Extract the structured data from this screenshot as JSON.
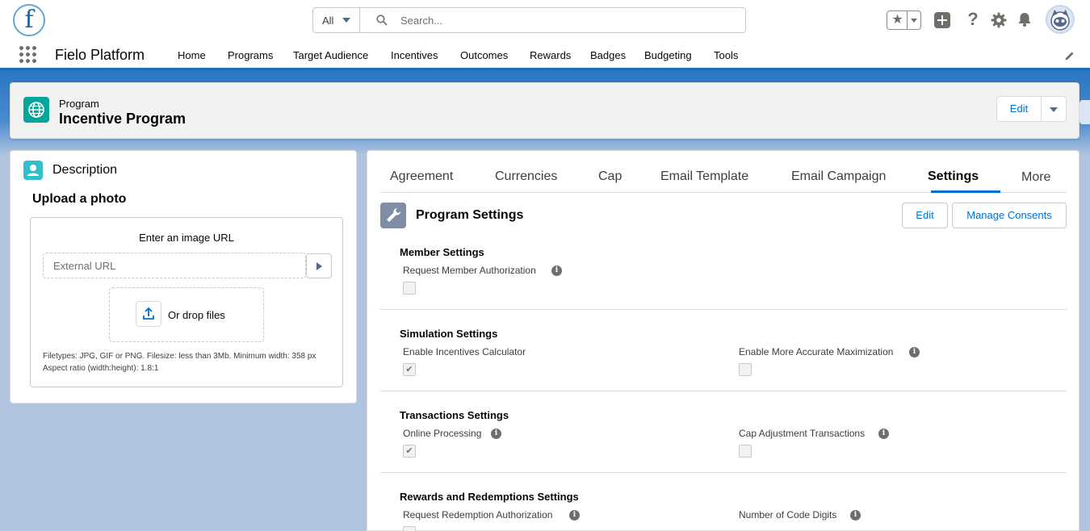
{
  "header": {
    "search_scope": "All",
    "search_placeholder": "Search...",
    "logo_letter": "f"
  },
  "nav": {
    "app_name": "Fielo Platform",
    "items": [
      "Home",
      "Programs",
      "Target Audience",
      "Incentives",
      "Outcomes",
      "Rewards",
      "Badges",
      "Budgeting",
      "Tools"
    ]
  },
  "record": {
    "type": "Program",
    "title": "Incentive Program",
    "edit_label": "Edit"
  },
  "description_card": {
    "title": "Description",
    "upload_title": "Upload a photo",
    "url_label": "Enter an image URL",
    "url_placeholder": "External URL",
    "drop_label": "Or drop files",
    "file_note_line1": "Filetypes: JPG, GIF or PNG. Filesize: less than 3Mb. Minimum width: 358 px",
    "file_note_line2": "Aspect ratio (width:height): 1.8:1"
  },
  "tabs": {
    "items": [
      "Agreement",
      "Currencies",
      "Cap",
      "Email Template",
      "Email Campaign",
      "Settings"
    ],
    "active": "Settings",
    "more_label": "More"
  },
  "program_settings": {
    "title": "Program Settings",
    "edit_label": "Edit",
    "manage_consents_label": "Manage Consents",
    "sections": [
      {
        "title": "Member Settings",
        "fields": [
          {
            "label": "Request Member Authorization",
            "checked": false
          }
        ]
      },
      {
        "title": "Simulation Settings",
        "fields": [
          {
            "label": "Enable Incentives Calculator",
            "checked": true
          },
          {
            "label": "Enable More Accurate Maximization",
            "checked": false
          }
        ]
      },
      {
        "title": "Transactions Settings",
        "fields": [
          {
            "label": "Online Processing",
            "checked": true
          },
          {
            "label": "Cap Adjustment Transactions",
            "checked": false
          }
        ]
      },
      {
        "title": "Rewards and Redemptions Settings",
        "fields": [
          {
            "label": "Request Redemption Authorization",
            "checked": false
          },
          {
            "label": "Number of Code Digits",
            "checked": false
          }
        ]
      }
    ]
  },
  "colors": {
    "brand_blue": "#0070d2",
    "program_icon": "#06a59a",
    "description_icon": "#34becd"
  },
  "icons": {
    "checkmark": "✔",
    "info": "i",
    "star": "★"
  }
}
